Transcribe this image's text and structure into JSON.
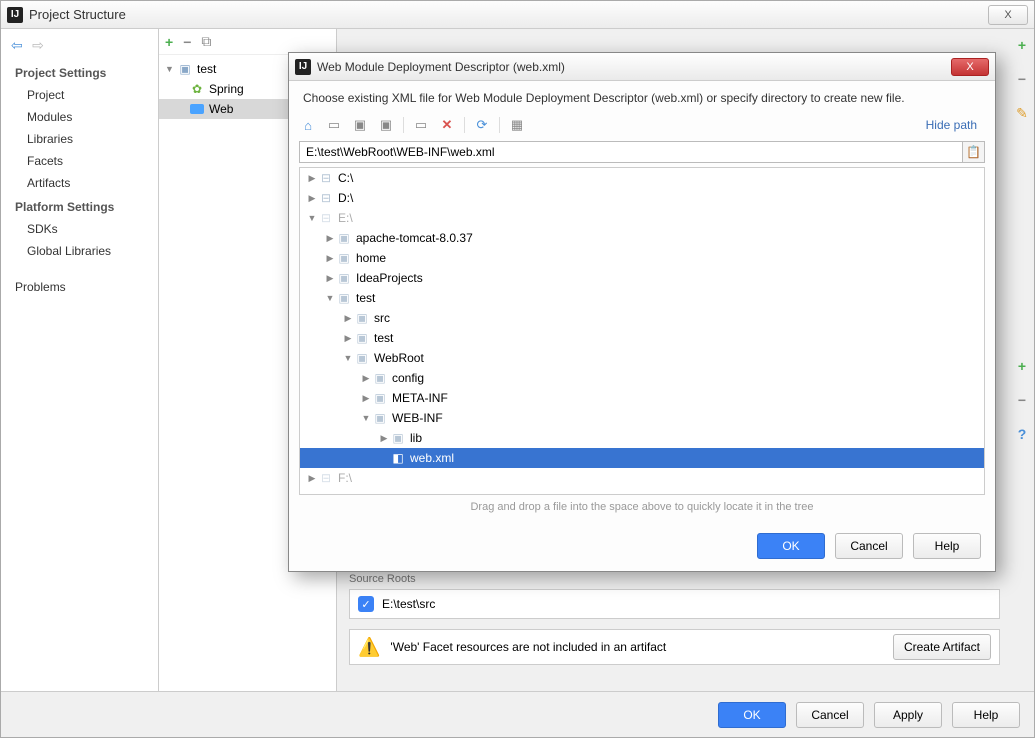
{
  "window": {
    "title": "Project Structure",
    "close_label": "X"
  },
  "sidebar": {
    "section1_title": "Project Settings",
    "section1_items": [
      "Project",
      "Modules",
      "Libraries",
      "Facets",
      "Artifacts"
    ],
    "section2_title": "Platform Settings",
    "section2_items": [
      "SDKs",
      "Global Libraries"
    ],
    "problems_label": "Problems"
  },
  "tree_panel": {
    "module_name": "test",
    "items": [
      {
        "label": "Spring",
        "type": "spring"
      },
      {
        "label": "Web",
        "type": "web",
        "selected": true
      }
    ]
  },
  "content": {
    "source_roots_label": "Source Roots",
    "source_root_path": "E:\\test\\src",
    "warning_text": "'Web' Facet resources are not included in an artifact",
    "create_artifact_label": "Create Artifact"
  },
  "buttons": {
    "ok": "OK",
    "cancel": "Cancel",
    "apply": "Apply",
    "help": "Help"
  },
  "modal": {
    "title": "Web Module Deployment Descriptor (web.xml)",
    "description": "Choose existing XML file for Web Module Deployment Descriptor (web.xml) or specify directory to create new file.",
    "hide_path_label": "Hide path",
    "path_value": "E:\\test\\WebRoot\\WEB-INF\\web.xml",
    "hint": "Drag and drop a file into the space above to quickly locate it in the tree",
    "tree": [
      {
        "indent": 0,
        "exp": "▶",
        "icon": "drive",
        "label": "C:\\"
      },
      {
        "indent": 0,
        "exp": "▶",
        "icon": "drive",
        "label": "D:\\"
      },
      {
        "indent": 0,
        "exp": "▼",
        "icon": "drive",
        "label": "E:\\",
        "light": true
      },
      {
        "indent": 1,
        "exp": "▶",
        "icon": "folder",
        "label": "apache-tomcat-8.0.37"
      },
      {
        "indent": 1,
        "exp": "▶",
        "icon": "folder",
        "label": "home"
      },
      {
        "indent": 1,
        "exp": "▶",
        "icon": "folder",
        "label": "IdeaProjects"
      },
      {
        "indent": 1,
        "exp": "▼",
        "icon": "folder",
        "label": "test"
      },
      {
        "indent": 2,
        "exp": "▶",
        "icon": "folder",
        "label": "src"
      },
      {
        "indent": 2,
        "exp": "▶",
        "icon": "folder",
        "label": "test"
      },
      {
        "indent": 2,
        "exp": "▼",
        "icon": "folder",
        "label": "WebRoot"
      },
      {
        "indent": 3,
        "exp": "▶",
        "icon": "folder",
        "label": "config"
      },
      {
        "indent": 3,
        "exp": "▶",
        "icon": "folder",
        "label": "META-INF"
      },
      {
        "indent": 3,
        "exp": "▼",
        "icon": "folder",
        "label": "WEB-INF"
      },
      {
        "indent": 4,
        "exp": "▶",
        "icon": "folder",
        "label": "lib"
      },
      {
        "indent": 4,
        "exp": "",
        "icon": "file",
        "label": "web.xml",
        "selected": true
      },
      {
        "indent": 0,
        "exp": "▶",
        "icon": "drive",
        "label": "F:\\",
        "light": true
      }
    ]
  }
}
